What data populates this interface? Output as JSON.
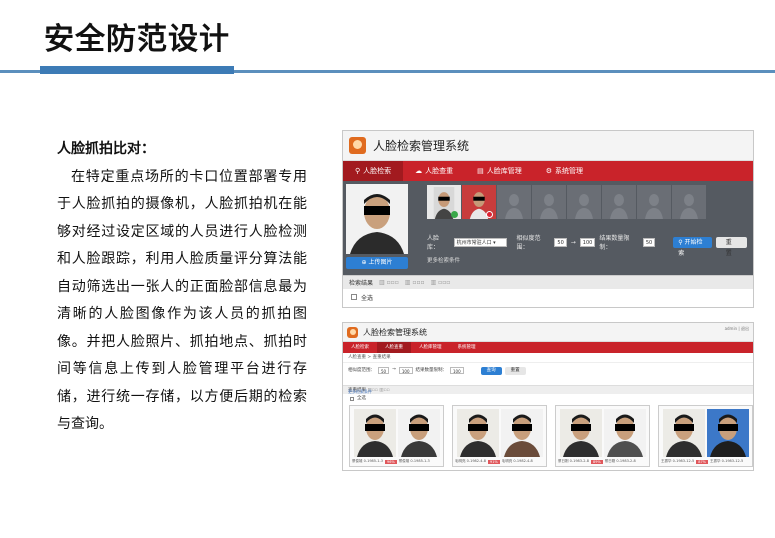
{
  "slide": {
    "title": "安全防范设计"
  },
  "description": {
    "heading": "人脸抓拍比对：",
    "body": "在特定重点场所的卡口位置部署专用于人脸抓拍的摄像机，人脸抓拍机在能够对经过设定区域的人员进行人脸检测和人脸跟踪，利用人脸质量评分算法能自动筛选出一张人的正面脸部信息最为清晰的人脸图像作为该人员的抓拍图像。并把人脸照片、抓拍地点、抓拍时间等信息上传到人脸管理平台进行存储，进行统一存储，以方便后期的检索与查询。"
  },
  "screenshot1": {
    "app_title": "人脸检索管理系统",
    "nav": [
      {
        "label": "人脸检索",
        "icon": "search-icon"
      },
      {
        "label": "人脸查重",
        "icon": "cloud-icon"
      },
      {
        "label": "人脸库管理",
        "icon": "id-card-icon"
      },
      {
        "label": "系统管理",
        "icon": "gear-icon"
      }
    ],
    "upload_label": "上传图片",
    "library_label": "人脸库：",
    "library_value": "杭州市常驻人口",
    "similarity_label": "相似度范围：",
    "similarity_min": "50",
    "similarity_max": "100",
    "result_limit_label": "结果数量限制：",
    "result_limit_value": "50",
    "search_button": "开始检索",
    "reset_button": "重置",
    "more_conditions": "更多检索条件",
    "results_label": "检索结果",
    "select_all": "全选"
  },
  "screenshot2": {
    "app_title": "人脸检索管理系统",
    "user_text": "admin | 退出",
    "nav": [
      "人脸检索",
      "人脸查重",
      "人脸库管理",
      "系统管理"
    ],
    "breadcrumb": "人脸查重 > 查重结果",
    "similarity_label": "相似度范围：",
    "similarity_min": "50",
    "similarity_max": "100",
    "result_limit_label": "结果数量限制：",
    "result_limit_value": "100",
    "search_button": "查询",
    "reset_button": "重置",
    "more_conditions": "更多检索条件",
    "results_label": "查重结果",
    "select_all": "全选",
    "cards": [
      {
        "left_caption": "蔡俊雄 0-1985-1-3",
        "score": "96%",
        "right_caption": "蔡俊雄 0-1985-1-3"
      },
      {
        "left_caption": "毛明亮 0-1982-4-8",
        "score": "91%",
        "right_caption": "毛明亮 0-1982-4-8"
      },
      {
        "left_caption": "蔡日刚 0-1983-2-8",
        "score": "89%",
        "right_caption": "蔡日刚 0-1983-2-8"
      },
      {
        "left_caption": "王振华 0-1983-12-5",
        "score": "87%",
        "right_caption": "王振华 0-1983-12-5"
      }
    ]
  },
  "colors": {
    "accent_blue": "#3d7bb6",
    "nav_red": "#c9232a",
    "button_blue": "#2d7fd3"
  }
}
